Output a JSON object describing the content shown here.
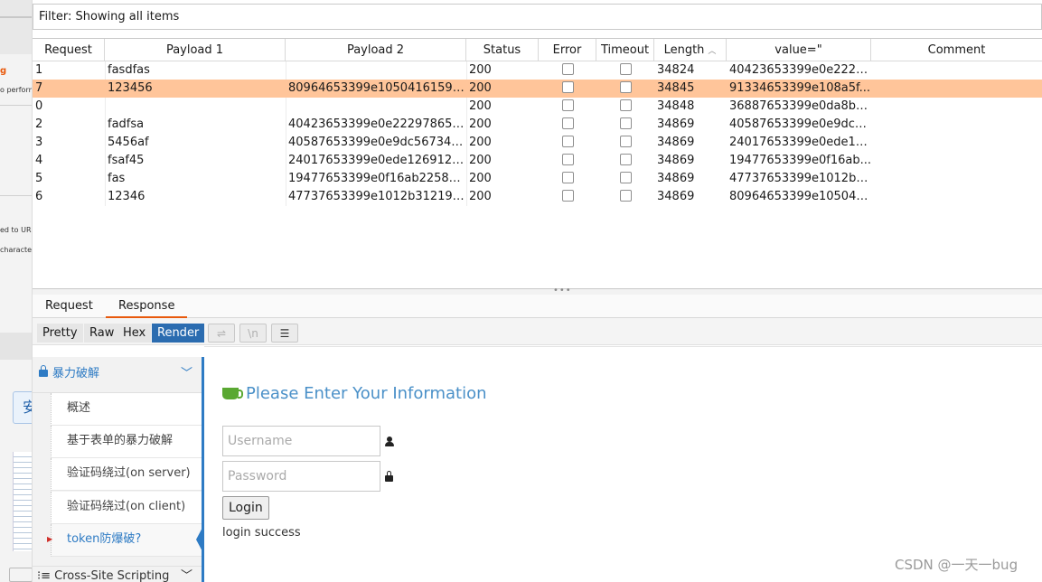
{
  "background_window": {
    "fragments": [
      "g",
      "o perform",
      "ed to URL",
      "characte"
    ],
    "button_label": "安"
  },
  "filter": {
    "text": "Filter: Showing all items"
  },
  "table": {
    "columns": [
      "Request",
      "Payload 1",
      "Payload 2",
      "Status",
      "Error",
      "Timeout",
      "Length",
      "value=\"",
      "Comment"
    ],
    "sorted_column": "Length",
    "rows": [
      {
        "request": "1",
        "payload1": "fasdfas",
        "payload2": "",
        "status": "200",
        "error": false,
        "timeout": false,
        "length": "34824",
        "value": "40423653399e0e2229...",
        "comment": "",
        "selected": false
      },
      {
        "request": "7",
        "payload1": "123456",
        "payload2": "80964653399e10504161598...",
        "status": "200",
        "error": false,
        "timeout": false,
        "length": "34845",
        "value": "91334653399e108a5f...",
        "comment": "",
        "selected": true
      },
      {
        "request": "0",
        "payload1": "",
        "payload2": "",
        "status": "200",
        "error": false,
        "timeout": false,
        "length": "34848",
        "value": "36887653399e0da8b9...",
        "comment": "",
        "selected": false
      },
      {
        "request": "2",
        "payload1": "fadfsa",
        "payload2": "40423653399e0e222978652...",
        "status": "200",
        "error": false,
        "timeout": false,
        "length": "34869",
        "value": "40587653399e0e9dc5...",
        "comment": "",
        "selected": false
      },
      {
        "request": "3",
        "payload1": "5456af",
        "payload2": "40587653399e0e9dc567340...",
        "status": "200",
        "error": false,
        "timeout": false,
        "length": "34869",
        "value": "24017653399e0ede12...",
        "comment": "",
        "selected": false
      },
      {
        "request": "4",
        "payload1": "fsaf45",
        "payload2": "24017653399e0ede1269125...",
        "status": "200",
        "error": false,
        "timeout": false,
        "length": "34869",
        "value": "19477653399e0f16ab...",
        "comment": "",
        "selected": false
      },
      {
        "request": "5",
        "payload1": "fas",
        "payload2": "19477653399e0f16ab22583...",
        "status": "200",
        "error": false,
        "timeout": false,
        "length": "34869",
        "value": "47737653399e1012b3...",
        "comment": "",
        "selected": false
      },
      {
        "request": "6",
        "payload1": "12346",
        "payload2": "47737653399e1012b312195...",
        "status": "200",
        "error": false,
        "timeout": false,
        "length": "34869",
        "value": "80964653399e105041...",
        "comment": "",
        "selected": false
      }
    ]
  },
  "tabs": {
    "request": "Request",
    "response": "Response",
    "active": "Response"
  },
  "view_buttons": {
    "pretty": "Pretty",
    "raw": "Raw",
    "hex": "Hex",
    "render": "Render",
    "active": "Render"
  },
  "icons": {
    "wrap": "wrap-icon",
    "newline": "newline-icon",
    "menu": "menu-icon"
  },
  "icon_glyphs": {
    "wrap": "⇌",
    "newline": "\\n",
    "menu": "☰"
  },
  "sidebar": {
    "header": "暴力破解",
    "items": [
      {
        "label": "概述",
        "active": false
      },
      {
        "label": "基于表单的暴力破解",
        "active": false
      },
      {
        "label": "验证码绕过(on server)",
        "active": false
      },
      {
        "label": "验证码绕过(on client)",
        "active": false
      },
      {
        "label": "token防爆破?",
        "active": true
      }
    ],
    "footer": "Cross-Site Scripting"
  },
  "form": {
    "title": "Please Enter Your Information",
    "username_placeholder": "Username",
    "password_placeholder": "Password",
    "login_label": "Login",
    "message": "login success"
  },
  "watermark": "CSDN @一天一bug",
  "colors": {
    "selected_row": "#ffc59a",
    "accent": "#2b6cb0",
    "tab_underline": "#e8590c",
    "sidebar_blue": "#2e7bc4",
    "title_blue": "#4a90c8"
  }
}
